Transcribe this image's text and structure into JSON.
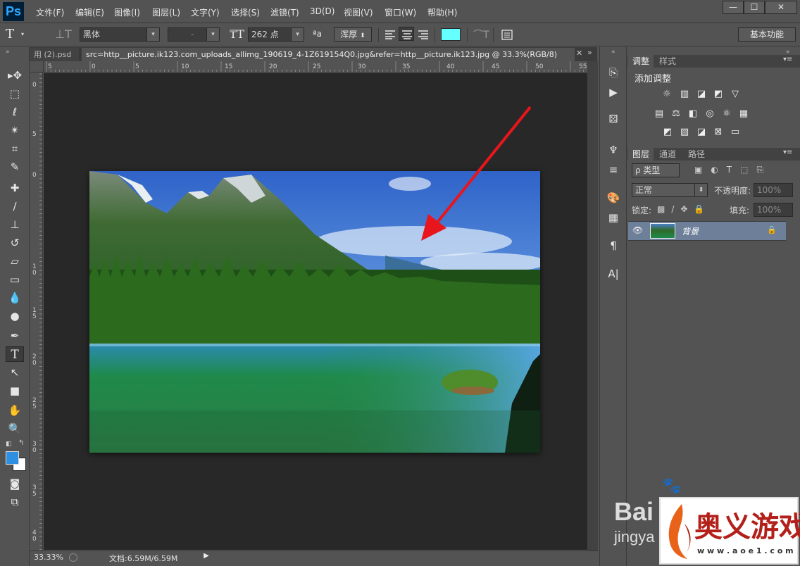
{
  "app": {
    "logo": "Ps"
  },
  "menu": [
    "文件(F)",
    "编辑(E)",
    "图像(I)",
    "图层(L)",
    "文字(Y)",
    "选择(S)",
    "滤镜(T)",
    "3D(D)",
    "视图(V)",
    "窗口(W)",
    "帮助(H)"
  ],
  "window_controls": {
    "minimize": "—",
    "maximize": "☐",
    "close": "✕"
  },
  "options": {
    "tool_icon": "T",
    "font_family": "黑体",
    "font_style": "-",
    "font_size": "262 点",
    "antialias_label": "ªa",
    "antialias": "浑厚",
    "text_color": "#66ffff",
    "workspace": "基本功能"
  },
  "tabs": {
    "inactive": "用 (2).psd",
    "active": "src=http__picture.ik123.com_uploads_allimg_190619_4-1Z619154Q0.jpg&refer=http__picture.ik123.jpg @ 33.3%(RGB/8)",
    "more": "»"
  },
  "ruler": {
    "h_labels": [
      "5",
      "0",
      "5",
      "10",
      "15",
      "20",
      "25",
      "30",
      "35",
      "40",
      "45",
      "50",
      "55"
    ],
    "v_labels": [
      "0",
      "5",
      "0",
      "1 0",
      "1 5",
      "2 0",
      "2 5",
      "3 0",
      "3 5",
      "4 0"
    ]
  },
  "status": {
    "zoom": "33.33%",
    "doc": "文档:6.59M/6.59M"
  },
  "panels": {
    "adjust_tab": "调整",
    "style_tab": "样式",
    "add_adjust": "添加调整",
    "layers_tab": "图层",
    "channels_tab": "通道",
    "paths_tab": "路径",
    "filter_kind": "ρ 类型",
    "blend_mode": "正常",
    "opacity_label": "不透明度:",
    "opacity": "100%",
    "lock_label": "锁定:",
    "fill_label": "填充:",
    "fill": "100%",
    "layer_name": "背景"
  },
  "watermark": {
    "baidu": "Bai",
    "jingyan": "jingya",
    "site": "奥义游戏网",
    "url": "w w w . a o e 1 . c o m"
  },
  "colors": {
    "foreground": "#2f8fe0",
    "background": "#ffffff",
    "accent": "#31a8ff"
  }
}
